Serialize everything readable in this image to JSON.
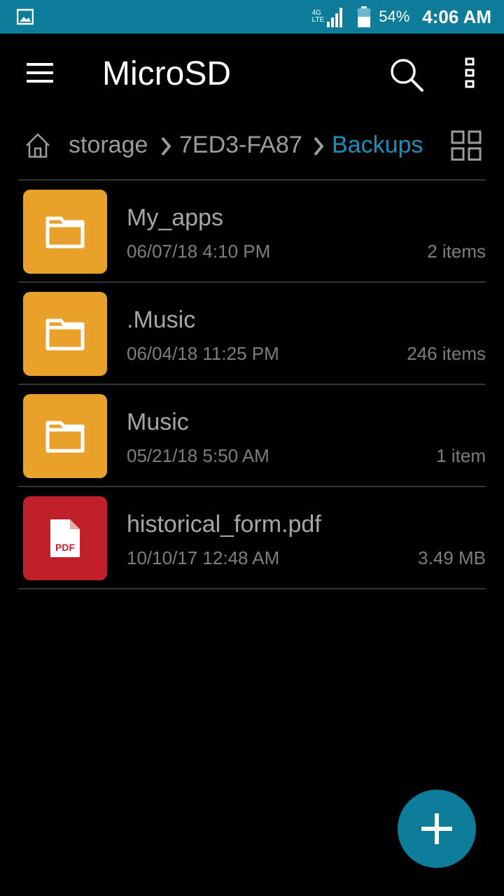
{
  "status_bar": {
    "network_top": "4G",
    "network_bottom": "LTE",
    "battery": "54%",
    "time": "4:06 AM",
    "left_icon": "image-notification-icon",
    "accent": "#0d7d9a"
  },
  "app_bar": {
    "title": "MicroSD",
    "icons": [
      "menu-icon",
      "search-icon",
      "more-vert-icon"
    ]
  },
  "breadcrumb": {
    "items": [
      "storage",
      "7ED3-FA87",
      "Backups"
    ],
    "active_color": "#1a8fb8"
  },
  "files": [
    {
      "name": "My_apps",
      "date": "06/07/18 4:10 PM",
      "meta": "2 items",
      "type": "folder",
      "color": "#e8a22c"
    },
    {
      "name": ".Music",
      "date": "06/04/18 11:25 PM",
      "meta": "246 items",
      "type": "folder",
      "color": "#e8a22c"
    },
    {
      "name": "Music",
      "date": "05/21/18 5:50 AM",
      "meta": "1 item",
      "type": "folder",
      "color": "#e8a22c"
    },
    {
      "name": "historical_form.pdf",
      "date": "10/10/17 12:48 AM",
      "meta": "3.49 MB",
      "type": "pdf",
      "color": "#c0202a",
      "icon_label": "PDF"
    }
  ],
  "fab": {
    "icon": "plus-icon"
  }
}
